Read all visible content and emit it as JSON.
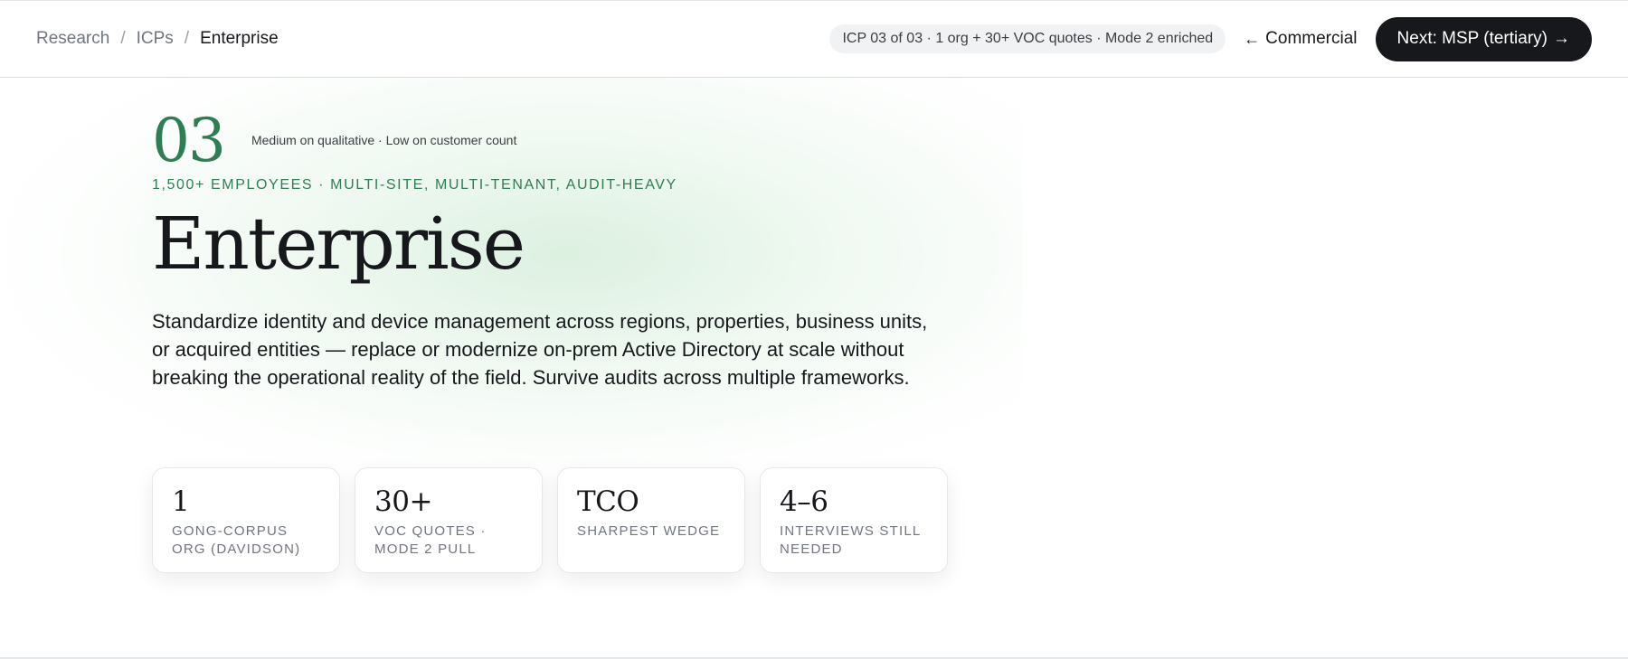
{
  "breadcrumb": {
    "items": [
      "Research",
      "ICPs",
      "Enterprise"
    ],
    "separator": "/"
  },
  "header": {
    "meta_pill": "ICP 03 of 03 · 1 org + 30+ VOC quotes · Mode 2 enriched",
    "back_label": "Commercial",
    "back_arrow": "←",
    "next_label": "Next: MSP (tertiary)",
    "next_arrow": "→"
  },
  "hero": {
    "number": "03",
    "confidence": "Medium on qualitative · Low on customer count",
    "segment_tag": "1,500+ EMPLOYEES · MULTI-SITE, MULTI-TENANT, AUDIT-HEAVY",
    "title": "Enterprise",
    "summary": "Standardize identity and device management across regions, properties, business units, or acquired entities — replace or modernize on-prem Active Directory at scale without breaking the operational reality of the field. Survive audits across multiple frameworks."
  },
  "stats": [
    {
      "value": "1",
      "label": "GONG-CORPUS ORG (DAVIDSON)"
    },
    {
      "value": "30+",
      "label": "VOC QUOTES · MODE 2 PULL"
    },
    {
      "value": "TCO",
      "label": "SHARPEST WEDGE"
    },
    {
      "value": "4–6",
      "label": "INTERVIEWS STILL NEEDED"
    }
  ],
  "colors": {
    "accent_green": "#2f7d52",
    "ink": "#16181b",
    "muted": "#707580",
    "button_bg": "#16181b"
  }
}
